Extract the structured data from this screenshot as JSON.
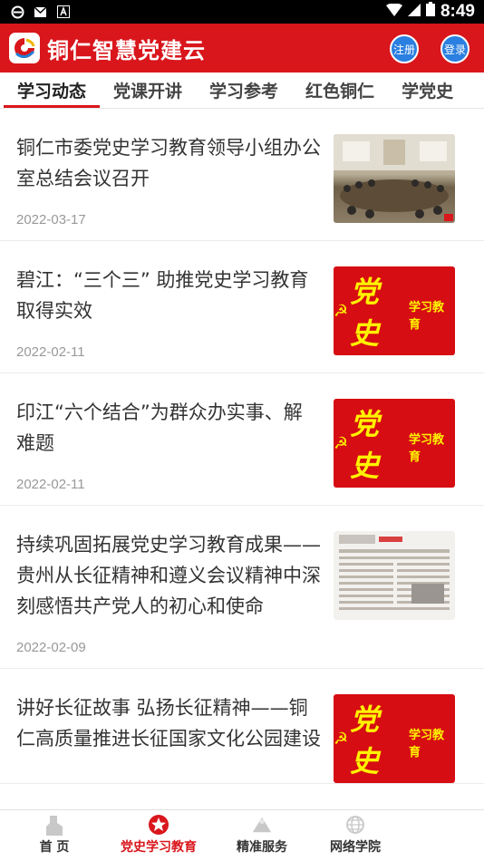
{
  "status_bar": {
    "time": "8:49"
  },
  "app": {
    "title": "铜仁智慧党建云",
    "register_label": "注册",
    "login_label": "登录"
  },
  "tabs": [
    "学习动态",
    "党课开讲",
    "学习参考",
    "红色铜仁",
    "学党史"
  ],
  "thumb_text": {
    "main": "党史",
    "sub": "学习教育"
  },
  "articles": [
    {
      "title": "铜仁市委党史学习教育领导小组办公室总结会议召开",
      "date": "2022-03-17",
      "thumb": "meeting"
    },
    {
      "title": "碧江：“三个三” 助推党史学习教育取得实效",
      "date": "2022-02-11",
      "thumb": "dangshi"
    },
    {
      "title": "印江“六个结合”为群众办实事、解难题",
      "date": "2022-02-11",
      "thumb": "dangshi"
    },
    {
      "title": "持续巩固拓展党史学习教育成果——贵州从长征精神和遵义会议精神中深刻感悟共产党人的初心和使命",
      "date": "2022-02-09",
      "thumb": "paper"
    },
    {
      "title": "讲好长征故事 弘扬长征精神——铜仁高质量推进长征国家文化公园建设",
      "date": "",
      "thumb": "dangshi"
    }
  ],
  "bottom_nav": [
    {
      "label": "首 页",
      "icon": "home-icon"
    },
    {
      "label": "党史学习教育",
      "icon": "star-badge-icon"
    },
    {
      "label": "精准服务",
      "icon": "service-icon"
    },
    {
      "label": "网络学院",
      "icon": "globe-icon"
    }
  ],
  "colors": {
    "primary": "#d9161c",
    "button_blue": "#2a7fe0"
  }
}
